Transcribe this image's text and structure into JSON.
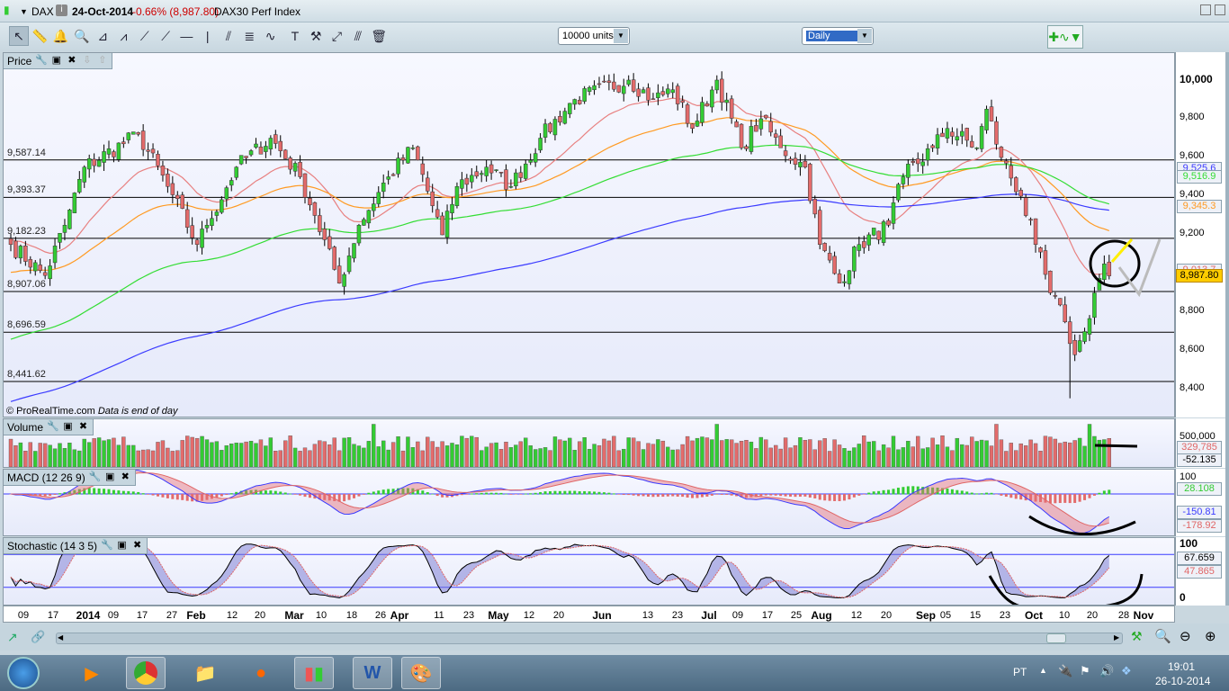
{
  "window": {
    "symbol": "DAX",
    "date": "24-Oct-2014",
    "change": "-0.66% (8,987.80)",
    "name": "DAX30 Perf Index"
  },
  "toolbar": {
    "tools": [
      "pointer",
      "ruler",
      "alert-bell",
      "zoom",
      "triangle-pattern",
      "channel",
      "segment",
      "line",
      "horizontal-line",
      "vertical-line",
      "parallel-lines",
      "fibonacci",
      "trend-channel",
      "text",
      "tools",
      "arrow-segment",
      "parallel-segment",
      "trash"
    ],
    "units": "10000 units",
    "period": "Daily"
  },
  "price_panel": {
    "title": "Price",
    "levels": [
      {
        "label": "9,587.14",
        "value": 9587.14
      },
      {
        "label": "9,393.37",
        "value": 9393.37
      },
      {
        "label": "9,182.23",
        "value": 9182.23
      },
      {
        "label": "8,907.06",
        "value": 8907.06
      },
      {
        "label": "8,696.59",
        "value": 8696.59
      },
      {
        "label": "8,441.62",
        "value": 8441.62
      }
    ],
    "axis": [
      {
        "label": "10,000",
        "value": 10000
      },
      {
        "label": "9,800",
        "value": 9800
      },
      {
        "label": "9,600",
        "value": 9600
      },
      {
        "label": "9,400",
        "value": 9400
      },
      {
        "label": "9,200",
        "value": 9200
      },
      {
        "label": "8,800",
        "value": 8800
      },
      {
        "label": "8,600",
        "value": 8600
      },
      {
        "label": "8,400",
        "value": 8400
      }
    ],
    "badges": [
      {
        "text": "9,525.6",
        "value": 9525.6,
        "color": "#3b3bff"
      },
      {
        "text": "9,516.9",
        "value": 9516.9,
        "color": "#33dd33"
      },
      {
        "text": "9,345.3",
        "value": 9345.3,
        "color": "#ff9a22"
      },
      {
        "text": "9,013.7",
        "value": 9013.7,
        "color": "#e06666"
      },
      {
        "text": "8,987.80",
        "value": 8987.8,
        "color": "#000"
      }
    ],
    "copyright": "© ProRealTime.com",
    "note": "Data is end of day"
  },
  "volume_panel": {
    "title": "Volume",
    "axis": "500,000",
    "badges": [
      "329,785",
      "-52.135"
    ]
  },
  "macd_panel": {
    "title": "MACD (12 26 9)",
    "axis": "100",
    "badges": [
      "28.108",
      "-150.81",
      "-178.92"
    ]
  },
  "stoch_panel": {
    "title": "Stochastic (14 3 5)",
    "axis": [
      "100",
      "0"
    ],
    "badges": [
      "67.659",
      "47.865"
    ]
  },
  "xaxis": [
    "09",
    "17",
    "2014",
    "09",
    "17",
    "27",
    "Feb",
    "12",
    "20",
    "Mar",
    "10",
    "18",
    "26",
    "Apr",
    "11",
    "23",
    "May",
    "12",
    "20",
    "Jun",
    "13",
    "23",
    "Jul",
    "09",
    "17",
    "25",
    "Aug",
    "12",
    "20",
    "Sep",
    "05",
    "15",
    "23",
    "Oct",
    "10",
    "20",
    "28",
    "Nov"
  ],
  "taskbar": {
    "lang": "PT",
    "time": "19:01",
    "date": "26-10-2014"
  },
  "colors": {
    "up": "#33cc33",
    "down": "#e36b6b",
    "ma20": "#e88080",
    "ma50": "#ff9a22",
    "ma100": "#33dd33",
    "ma200": "#3b3bff"
  },
  "chart_data": {
    "type": "candlestick",
    "title": "DAX30 Perf Index — Daily",
    "ylim": [
      8330,
      10100
    ],
    "anchors": [
      [
        0,
        9150
      ],
      [
        7,
        8990
      ],
      [
        11,
        9250
      ],
      [
        15,
        9550
      ],
      [
        26,
        9720
      ],
      [
        32,
        9450
      ],
      [
        38,
        9150
      ],
      [
        40,
        9250
      ],
      [
        46,
        9550
      ],
      [
        53,
        9700
      ],
      [
        59,
        9500
      ],
      [
        62,
        9300
      ],
      [
        67,
        8950
      ],
      [
        71,
        9250
      ],
      [
        77,
        9500
      ],
      [
        82,
        9650
      ],
      [
        88,
        9200
      ],
      [
        91,
        9450
      ],
      [
        97,
        9550
      ],
      [
        102,
        9450
      ],
      [
        108,
        9700
      ],
      [
        115,
        9900
      ],
      [
        126,
        10000
      ],
      [
        131,
        9900
      ],
      [
        135,
        9950
      ],
      [
        139,
        9750
      ],
      [
        144,
        10000
      ],
      [
        149,
        9650
      ],
      [
        153,
        9800
      ],
      [
        157,
        9650
      ],
      [
        162,
        9550
      ],
      [
        165,
        9150
      ],
      [
        169,
        8950
      ],
      [
        173,
        9150
      ],
      [
        179,
        9250
      ],
      [
        182,
        9500
      ],
      [
        188,
        9650
      ],
      [
        191,
        9750
      ],
      [
        197,
        9650
      ],
      [
        199,
        9850
      ],
      [
        202,
        9600
      ],
      [
        206,
        9400
      ],
      [
        209,
        9150
      ],
      [
        212,
        8900
      ],
      [
        215,
        8750
      ],
      [
        217,
        8580
      ],
      [
        219,
        8700
      ],
      [
        221,
        8900
      ],
      [
        223,
        9050
      ],
      [
        224,
        8987.8
      ]
    ],
    "ma_seeds": {
      "ma20": 9180,
      "ma50": 9000,
      "ma100": 8650,
      "ma200": 8330
    }
  }
}
